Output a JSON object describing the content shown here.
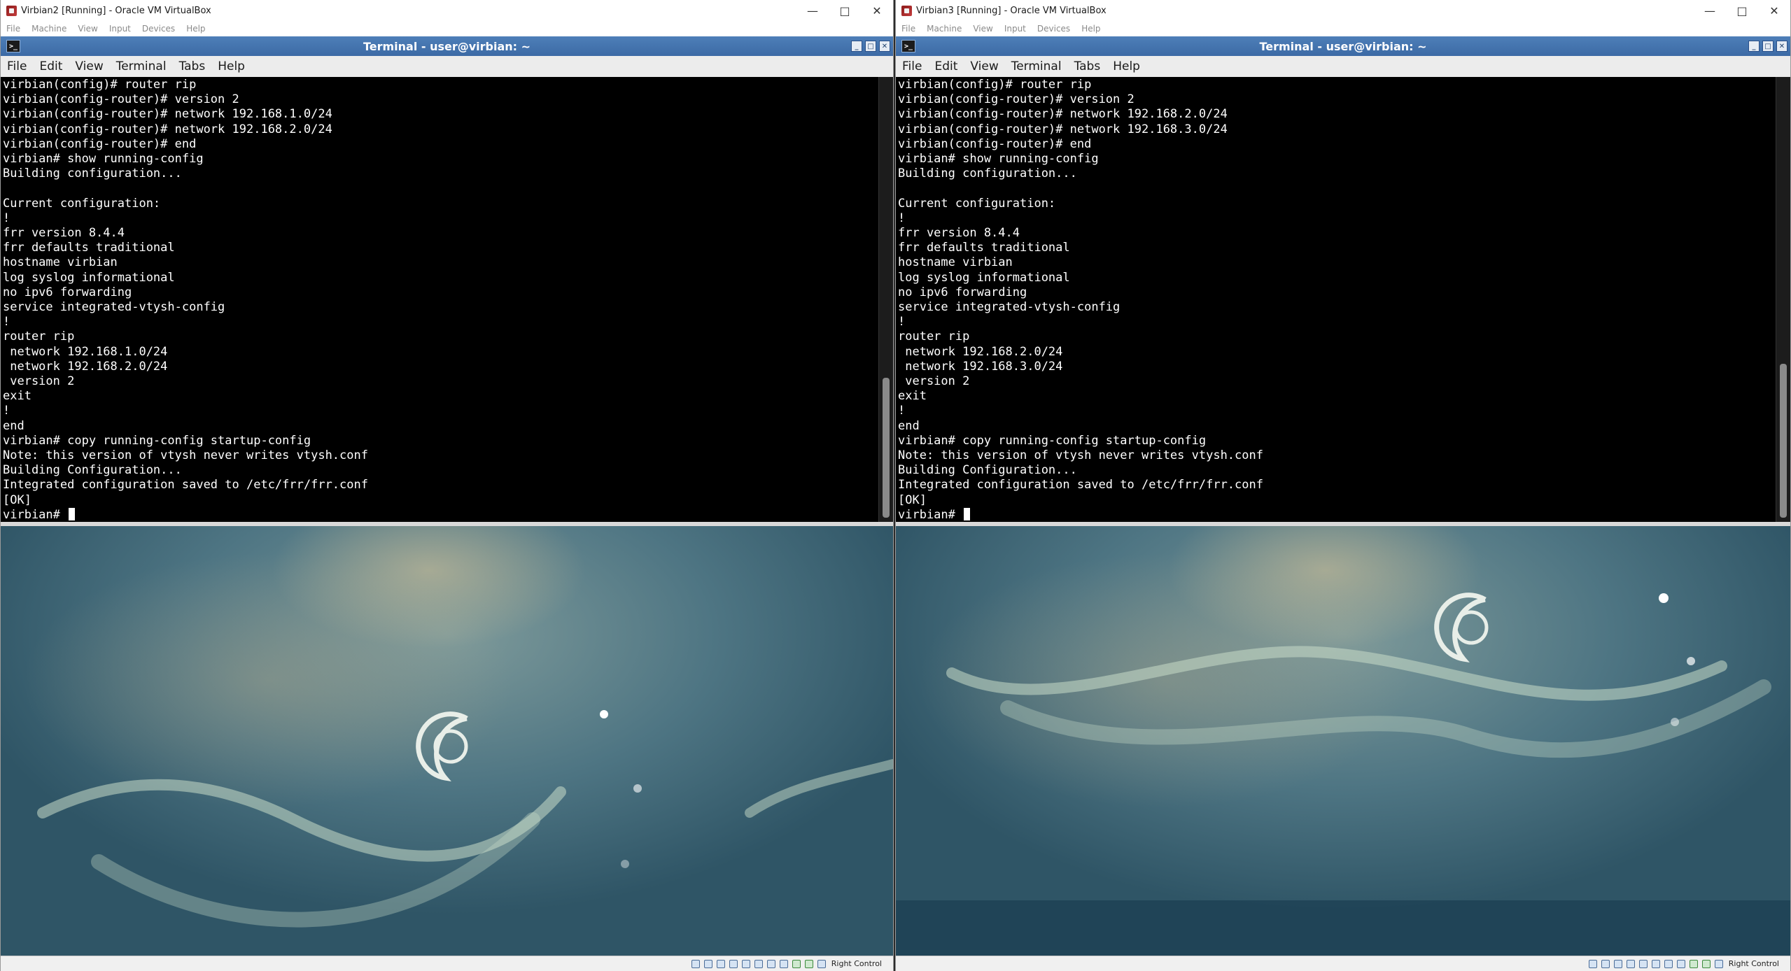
{
  "vm_left": {
    "window_title": "Virbian2 [Running] - Oracle VM VirtualBox",
    "menu": [
      "File",
      "Machine",
      "View",
      "Input",
      "Devices",
      "Help"
    ],
    "terminal": {
      "title": "Terminal - user@virbian: ~",
      "menu": [
        "File",
        "Edit",
        "View",
        "Terminal",
        "Tabs",
        "Help"
      ],
      "lines": [
        "virbian(config)# router rip",
        "virbian(config-router)# version 2",
        "virbian(config-router)# network 192.168.1.0/24",
        "virbian(config-router)# network 192.168.2.0/24",
        "virbian(config-router)# end",
        "virbian# show running-config",
        "Building configuration...",
        "",
        "Current configuration:",
        "!",
        "frr version 8.4.4",
        "frr defaults traditional",
        "hostname virbian",
        "log syslog informational",
        "no ipv6 forwarding",
        "service integrated-vtysh-config",
        "!",
        "router rip",
        " network 192.168.1.0/24",
        " network 192.168.2.0/24",
        " version 2",
        "exit",
        "!",
        "end",
        "virbian# copy running-config startup-config",
        "Note: this version of vtysh never writes vtysh.conf",
        "Building Configuration...",
        "Integrated configuration saved to /etc/frr/frr.conf",
        "[OK]"
      ],
      "prompt": "virbian# "
    },
    "host_key": "Right Control"
  },
  "vm_right": {
    "window_title": "Virbian3 [Running] - Oracle VM VirtualBox",
    "menu": [
      "File",
      "Machine",
      "View",
      "Input",
      "Devices",
      "Help"
    ],
    "terminal": {
      "title": "Terminal - user@virbian: ~",
      "menu": [
        "File",
        "Edit",
        "View",
        "Terminal",
        "Tabs",
        "Help"
      ],
      "lines": [
        "virbian(config)# router rip",
        "virbian(config-router)# version 2",
        "virbian(config-router)# network 192.168.2.0/24",
        "virbian(config-router)# network 192.168.3.0/24",
        "virbian(config-router)# end",
        "virbian# show running-config",
        "Building configuration...",
        "",
        "Current configuration:",
        "!",
        "frr version 8.4.4",
        "frr defaults traditional",
        "hostname virbian",
        "log syslog informational",
        "no ipv6 forwarding",
        "service integrated-vtysh-config",
        "!",
        "router rip",
        " network 192.168.2.0/24",
        " network 192.168.3.0/24",
        " version 2",
        "exit",
        "!",
        "end",
        "virbian# copy running-config startup-config",
        "Note: this version of vtysh never writes vtysh.conf",
        "Building Configuration...",
        "Integrated configuration saved to /etc/frr/frr.conf",
        "[OK]"
      ],
      "prompt": "virbian# "
    },
    "host_key": "Right Control"
  }
}
